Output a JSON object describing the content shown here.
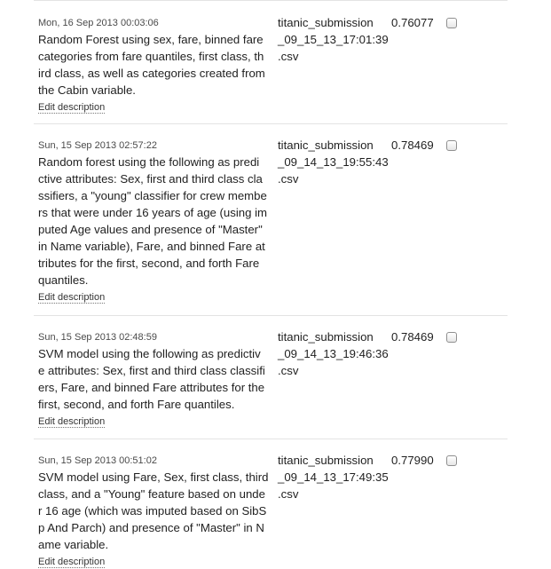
{
  "edit_label": "Edit description",
  "submissions": [
    {
      "date": "Mon, 16 Sep 2013 00:03:06",
      "description": "Random Forest using sex, fare, binned fare\ncategories from fare quantiles, first class, th\nird class, as well as categories created from\nthe Cabin variable.",
      "file": "titanic_submission\n_09_15_13_17:01:39\n.csv",
      "score": "0.76077"
    },
    {
      "date": "Sun, 15 Sep 2013 02:57:22",
      "description": "Random forest using the following as predi\nctive attributes: Sex, first and third class cla\nssifiers, a \"young\" classifier for crew membe\nrs that were under 16 years of age (using im\nputed Age values and presence of \"Master\"\nin Name variable), Fare, and binned Fare at\ntributes for the first, second, and forth Fare\nquantiles.",
      "file": "titanic_submission\n_09_14_13_19:55:43\n.csv",
      "score": "0.78469"
    },
    {
      "date": "Sun, 15 Sep 2013 02:48:59",
      "description": "SVM model using the following as predictiv\ne attributes: Sex, first and third class classifi\ners, Fare, and binned Fare attributes for the\nfirst, second, and forth Fare quantiles.",
      "file": "titanic_submission\n_09_14_13_19:46:36\n.csv",
      "score": "0.78469"
    },
    {
      "date": "Sun, 15 Sep 2013 00:51:02",
      "description": "SVM model using Fare, Sex, first class, third\nclass, and a \"Young\" feature based on unde\nr 16 age (which was imputed based on SibS\np And Parch) and presence of \"Master\" in N\name variable.",
      "file": "titanic_submission\n_09_14_13_17:49:35\n.csv",
      "score": "0.77990"
    }
  ]
}
